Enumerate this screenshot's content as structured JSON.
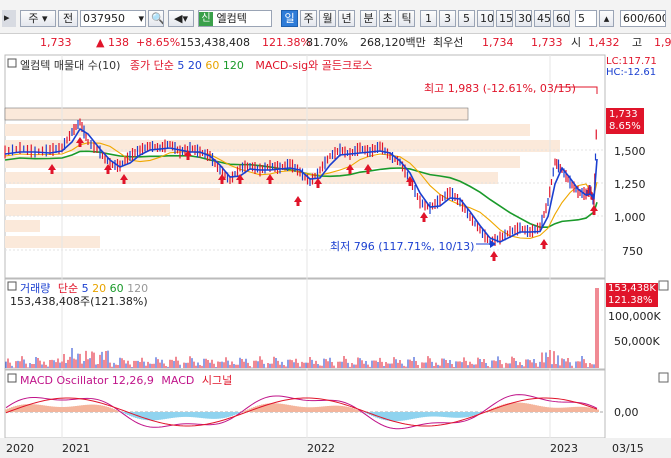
{
  "toolbar": {
    "market": "주",
    "jeon": "전",
    "code": "037950",
    "sin_badge": "신",
    "stock_name": "엘컴텍",
    "periods": [
      "일",
      "주",
      "월",
      "년",
      "분",
      "초",
      "틱"
    ],
    "active_period": "일",
    "intervals": [
      "1",
      "3",
      "5",
      "10",
      "15",
      "30",
      "45",
      "60"
    ],
    "interval_value": "5",
    "count_value": "600",
    "count_total": "/600"
  },
  "quote": {
    "price": "1,733",
    "change": "138",
    "change_pct": "+8.65%",
    "volume": "153,438,408",
    "volume_ratio": "121.38%",
    "ratio2": "81.70%",
    "amount": "268,120백만",
    "seller_label": "최우선",
    "ask": "1,734",
    "bid": "1,733",
    "open_label": "시",
    "open": "1,432",
    "high_label": "고",
    "high": "1,9"
  },
  "price_panel": {
    "legend": {
      "title": "엘컴텍 매물대 수(10)",
      "ma_label": "종가 단순",
      "ma_periods": [
        "5",
        "20",
        "60",
        "120"
      ],
      "macd_sig": "MACD-sig와 골든크로스"
    },
    "lc": "LC:117.71",
    "hc": "HC:-12.61",
    "high_annot": "최고 1,983 (-12.61%, 03/15)",
    "low_annot": "최저 796 (117.71%, 10/13)",
    "price_tag": "1,733",
    "pct_tag": "8.65%",
    "y_ticks": [
      "1,500",
      "1,250",
      "1,000",
      "750"
    ]
  },
  "volume_panel": {
    "legend_title": "거래량",
    "legend_ma": "단순",
    "ma_periods": [
      "5",
      "20",
      "60",
      "120"
    ],
    "info": "153,438,408주(121.38%)",
    "tag": "153,438K",
    "tag_pct": "121.38%",
    "y_ticks": [
      "100,000K",
      "50,000K"
    ]
  },
  "macd_panel": {
    "legend": "MACD Oscillator 12,26,9",
    "macd": "MACD",
    "signal": "시그널",
    "y_tick": "0,00"
  },
  "x_axis": {
    "labels": [
      "2020",
      "2021",
      "2022",
      "2023"
    ],
    "end_label": "03/15"
  },
  "colors": {
    "up": "#e0142a",
    "down": "#1a3fd0",
    "ma5": "#1a3fd0",
    "ma20": "#f0a800",
    "ma60": "#1a9a2a",
    "ma120": "#999999"
  }
}
